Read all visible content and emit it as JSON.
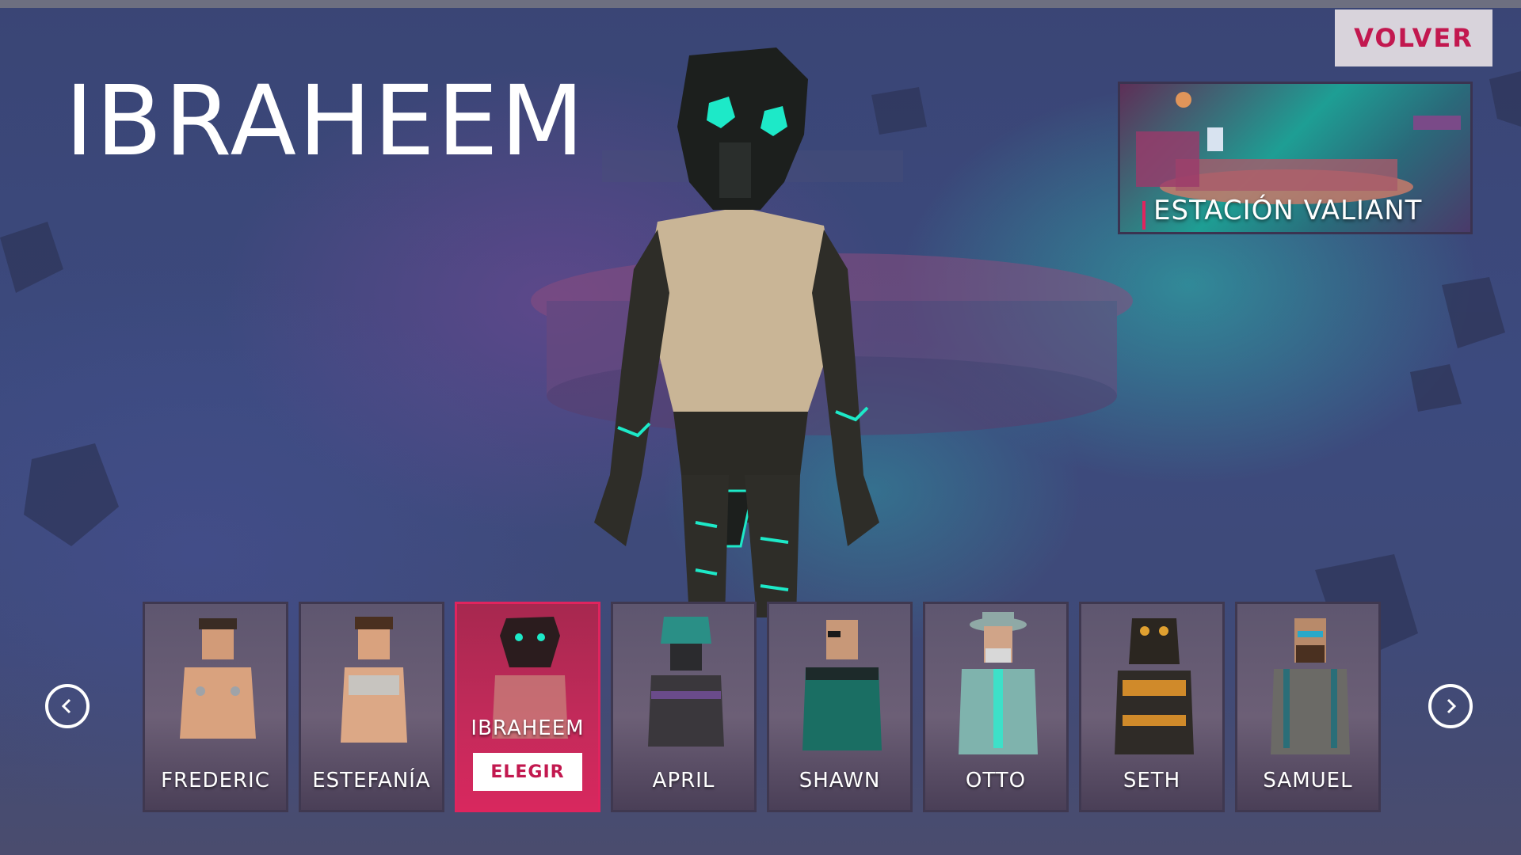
{
  "character": {
    "name": "IBRAHEEM"
  },
  "back_button": {
    "label": "VOLVER"
  },
  "location": {
    "name": "ESTACIÓN VALIANT"
  },
  "roster": {
    "choose_label": "ELEGIR",
    "selected_index": 2,
    "items": [
      {
        "name": "FREDERIC"
      },
      {
        "name": "ESTEFANÍA"
      },
      {
        "name": "IBRAHEEM"
      },
      {
        "name": "APRIL"
      },
      {
        "name": "SHAWN"
      },
      {
        "name": "OTTO"
      },
      {
        "name": "SETH"
      },
      {
        "name": "SAMUEL"
      }
    ]
  },
  "navigation": {
    "prev_icon": "chevron-left-icon",
    "next_icon": "chevron-right-icon"
  },
  "colors": {
    "accent": "#e0245e",
    "selected_card": "#c22a5a",
    "cyan_glow": "#1de9c8"
  }
}
